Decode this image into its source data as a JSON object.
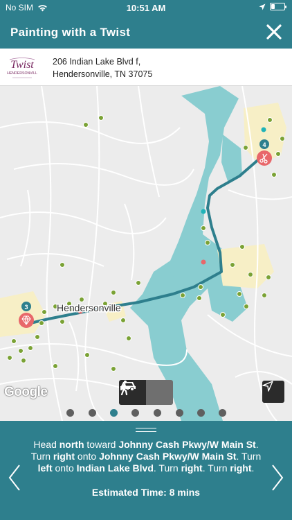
{
  "status_bar": {
    "carrier": "No SIM",
    "time": "10:51 AM",
    "battery_level": 0.3
  },
  "header": {
    "title": "Painting with a Twist",
    "close_icon": "close-icon"
  },
  "venue": {
    "logo_brand": "Twist",
    "logo_location": "HENDERSONVILL",
    "address_line1": "206 Indian Lake Blvd f,",
    "address_line2": "Hendersonville, TN 37075"
  },
  "map": {
    "place_label": "Hendersonville",
    "attribution": "Google",
    "markers": [
      {
        "number": "4",
        "icon": "scissors-icon"
      },
      {
        "number": "3",
        "icon": "diamond-icon"
      }
    ],
    "colors": {
      "route": "#2e7f8d",
      "water": "#89cdd0",
      "land": "#ececec",
      "park": "#f7efc6",
      "marker": "#e8676a",
      "poi": "#7aa235"
    },
    "transport_modes": [
      "car-icon",
      "walk-icon"
    ],
    "selected_mode": "car",
    "locate_icon": "location-arrow-icon",
    "pages": {
      "count": 8,
      "active_index": 2
    }
  },
  "directions": {
    "parts": [
      {
        "t": "Head ",
        "b": false
      },
      {
        "t": "north",
        "b": true
      },
      {
        "t": " toward ",
        "b": false
      },
      {
        "t": "Johnny Cash Pkwy/W Main St",
        "b": true
      },
      {
        "t": ". Turn ",
        "b": false
      },
      {
        "t": "right",
        "b": true
      },
      {
        "t": " onto ",
        "b": false
      },
      {
        "t": "Johnny Cash Pkwy/W Main St",
        "b": true
      },
      {
        "t": ". Turn ",
        "b": false
      },
      {
        "t": "left",
        "b": true
      },
      {
        "t": " onto ",
        "b": false
      },
      {
        "t": "Indian Lake Blvd",
        "b": true
      },
      {
        "t": ". Turn ",
        "b": false
      },
      {
        "t": "right",
        "b": true
      },
      {
        "t": ". Turn ",
        "b": false
      },
      {
        "t": "right",
        "b": true
      },
      {
        "t": ".",
        "b": false
      }
    ],
    "estimated_time": "Estimated Time: 8 mins"
  }
}
